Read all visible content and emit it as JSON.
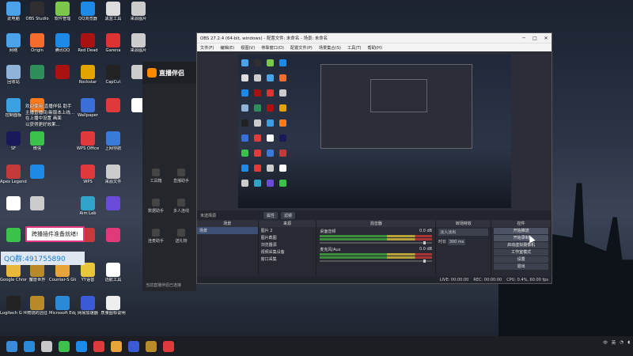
{
  "desktop_icons": [
    {
      "label": "此电脑",
      "color": "#4aa3e8"
    },
    {
      "label": "OBS Studio",
      "color": "#302e31"
    },
    {
      "label": "软件管理",
      "color": "#7bc84a"
    },
    {
      "label": "QQ浏览器",
      "color": "#1e8ae8"
    },
    {
      "label": "黑盒工具",
      "color": "#dddddd"
    },
    {
      "label": "来源图片",
      "color": "#cccccc"
    },
    {
      "label": "网络",
      "color": "#4aa3e8"
    },
    {
      "label": "Origin",
      "color": "#f56c2d"
    },
    {
      "label": "腾讯QQ",
      "color": "#1e8ae8"
    },
    {
      "label": "Red Dead",
      "color": "#aa1111"
    },
    {
      "label": "Garena",
      "color": "#dd3333"
    },
    {
      "label": "来源图片",
      "color": "#cccccc"
    },
    {
      "label": "回收站",
      "color": "#8fb3d9"
    },
    {
      "label": "",
      "color": "#2f8f5a"
    },
    {
      "label": "",
      "color": "#aa1111"
    },
    {
      "label": "Rockstar",
      "color": "#e4a400"
    },
    {
      "label": "CapCut",
      "color": "#222222"
    },
    {
      "label": "",
      "color": "#cccccc"
    },
    {
      "label": "控制面板",
      "color": "#3ba0e0"
    },
    {
      "label": "",
      "color": "#ff7a1a"
    },
    {
      "label": "Wallpaper",
      "color": "#3a6fd8"
    },
    {
      "label": "",
      "color": "#e03a3a"
    },
    {
      "label": "",
      "color": "#ffffff"
    },
    {
      "label": "SF",
      "color": "#1a1a5a"
    },
    {
      "label": "微信",
      "color": "#3ac24a"
    },
    {
      "label": "WPS Office",
      "color": "#e03a3a"
    },
    {
      "label": "上网导航",
      "color": "#3a7ad8"
    },
    {
      "label": "Apex Legends",
      "color": "#c43a3a"
    },
    {
      "label": "",
      "color": "#1e8ae8"
    },
    {
      "label": "WPS",
      "color": "#e03a3a"
    },
    {
      "label": "来源文件",
      "color": "#cccccc"
    },
    {
      "label": "",
      "color": "#ffffff"
    },
    {
      "label": "",
      "color": "#cccccc"
    },
    {
      "label": "Aim Lab",
      "color": "#2fa3c8"
    },
    {
      "label": "",
      "color": "#6a4ad8"
    },
    {
      "label": "",
      "color": "#3ac24a"
    },
    {
      "label": "",
      "color": "#cccccc"
    },
    {
      "label": "",
      "color": "#c83a3a"
    },
    {
      "label": "",
      "color": "#e03a7a"
    },
    {
      "label": "Google Chrome",
      "color": "#e8b83a"
    },
    {
      "label": "魔兽世界",
      "color": "#b88a2a"
    },
    {
      "label": "Counter-S Global Off...",
      "color": "#e8a43a"
    },
    {
      "label": "YY语音",
      "color": "#e8c83a"
    },
    {
      "label": "远航工具",
      "color": "#ffffff"
    },
    {
      "label": "Logitech G HUB",
      "color": "#222222"
    },
    {
      "label": "燃烧的远征",
      "color": "#b88a2a"
    },
    {
      "label": "Microsoft Edge",
      "color": "#2a8ad8"
    },
    {
      "label": "网易加速器",
      "color": "#3a5ad8"
    },
    {
      "label": "质量图标说明",
      "color": "#eeeeee"
    }
  ],
  "notes_lines": [
    "欢迎使用 直播伴侣 助手",
    "主播直播间/新版本上线...",
    "在上播中设置 画面",
    "以获得更好效果..."
  ],
  "plugin_toast": "跨播插件准备就绪!",
  "qq_label": "QQ群:491755890",
  "live_app": {
    "title": "直播伴侣",
    "nav": [
      {
        "label": "工具箱"
      },
      {
        "label": "直播助手"
      },
      {
        "label": "数据助手"
      },
      {
        "label": "多人连线"
      },
      {
        "label": "连麦助手"
      },
      {
        "label": "送礼物"
      }
    ],
    "bottom_link": "当前直播伴侣已连接"
  },
  "obs": {
    "title": "OBS 27.2.4 (64-bit, windows) - 配置文件: 未命名 - 场景: 未命名",
    "menu": [
      "文件(F)",
      "编辑(E)",
      "视图(V)",
      "停靠窗口(D)",
      "配置文件(P)",
      "场景集合(S)",
      "工具(T)",
      "帮助(H)"
    ],
    "scene_tabs": [
      "未选择源",
      "属性",
      "滤镜"
    ],
    "docks": {
      "scenes": {
        "header": "场景",
        "items": [
          "场景"
        ]
      },
      "sources": {
        "header": "来源",
        "items": [
          "图片 2",
          "图片截图",
          "浏览器源",
          "视频采集设备",
          "窗口采集"
        ]
      },
      "mixer": {
        "header": "混音器",
        "channels": [
          {
            "name": "桌面音频",
            "db": "0.0 dB"
          },
          {
            "name": "麦克风/Aux",
            "db": "0.0 dB"
          }
        ]
      },
      "transitions": {
        "header": "转场特效",
        "value": "淡入淡出",
        "duration_label": "时长",
        "duration": "300 ms"
      },
      "controls": {
        "header": "控件",
        "buttons": [
          "开始推流",
          "开始录制",
          "启动虚拟摄像机",
          "工作室模式",
          "设置",
          "退出"
        ]
      }
    },
    "status": {
      "live": "LIVE: 00:00:00",
      "rec": "REC: 00:00:00",
      "cpu": "CPU: 0.4%, 60.00 fps"
    }
  },
  "taskbar": {
    "icons": [
      "#2a8ad8",
      "#c8c8c8",
      "#3ac24a",
      "#1e8ae8",
      "#e03a3a",
      "#e8a43a",
      "#3a5ad8",
      "#b88a2a",
      "#e03a3a"
    ],
    "lang": "中",
    "lang2": "英",
    "clock": ""
  }
}
